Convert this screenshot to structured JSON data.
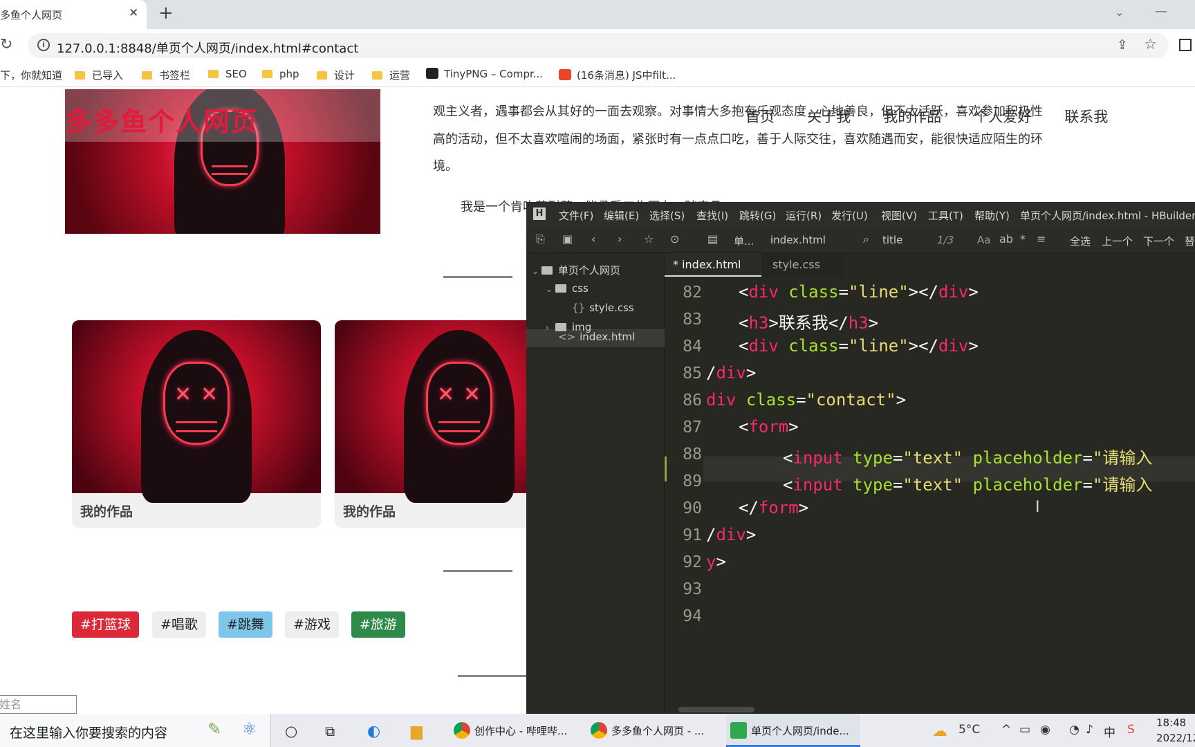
{
  "browser": {
    "tab_title": "多鱼个人网页",
    "tab_close": "✕",
    "new_tab": "+",
    "url": "127.0.0.1:8848/单页个人网页/index.html#contact",
    "bookmarks": [
      {
        "label": "下，你就知道",
        "icon": "none"
      },
      {
        "label": "已导入",
        "icon": "folder-icon"
      },
      {
        "label": "书签栏",
        "icon": "folder-icon"
      },
      {
        "label": "SEO",
        "icon": "folder-icon"
      },
      {
        "label": "php",
        "icon": "folder-icon"
      },
      {
        "label": "设计",
        "icon": "folder-icon"
      },
      {
        "label": "运营",
        "icon": "folder-icon"
      },
      {
        "label": "TinyPNG – Compr...",
        "icon": "panda-icon"
      },
      {
        "label": "(16条消息) JS中filt...",
        "icon": "csdn-icon"
      }
    ]
  },
  "webpage": {
    "logo": "多多鱼个人网页",
    "nav": [
      "首页",
      "关于我",
      "我的作品",
      "个人爱好",
      "联系我"
    ],
    "about_lines": [
      "观主义者，遇事都会从其好的一面去观察。对事情大多抱有乐观态度，心地善良，但不太活跃，喜欢参加积极性",
      "高的活动，但不太喜欢喧闹的场面，紧张时有一点点口吃，善于人际交往，喜欢随遇而安，能很快适应陌生的环",
      "境。",
      "我是一个肯吃苦耐劳，能承受工作压力，踏实且"
    ],
    "works": [
      {
        "caption": "我的作品"
      },
      {
        "caption": "我的作品"
      }
    ],
    "tags": [
      "#打篮球",
      "#唱歌",
      "#跳舞",
      "#游戏",
      "#旅游"
    ],
    "tag_colors": [
      "#dc2939",
      "#eeeeee",
      "#7ec6ea",
      "#eeeeee",
      "#2f8a4a"
    ],
    "name_input_placeholder": "姓名"
  },
  "hbuilder": {
    "menu": [
      "文件(F)",
      "编辑(E)",
      "选择(S)",
      "查找(I)",
      "跳转(G)",
      "运行(R)",
      "发行(U)",
      "视图(V)",
      "工具(T)",
      "帮助(Y)"
    ],
    "title": "单页个人网页/index.html - HBuilder",
    "toolbar": {
      "crumb_project": "单...",
      "crumb_file": "index.html",
      "search_term": "title",
      "match_count": "1/3",
      "case_label": "Aa",
      "select_all": "全选",
      "prev": "上一个",
      "next": "下一个",
      "replace": "替"
    },
    "tree": {
      "project": "单页个人网页",
      "css_folder": "css",
      "css_file": "style.css",
      "img_folder": "img",
      "index_file": "index.html"
    },
    "tabs": {
      "active": "* index.html",
      "inactive": "style.css"
    },
    "code_lines": [
      {
        "n": "82",
        "text": "<div class=\"line\"></div>"
      },
      {
        "n": "83",
        "text": "<h3>联系我</h3>"
      },
      {
        "n": "84",
        "text": "<div class=\"line\"></div>"
      },
      {
        "n": "85",
        "text": "/div>"
      },
      {
        "n": "86",
        "text": "div class=\"contact\">"
      },
      {
        "n": "87",
        "text": "<form>"
      },
      {
        "n": "88",
        "text": "<input type=\"text\" placeholder=\"请输入"
      },
      {
        "n": "89",
        "text": "<input type=\"text\" placeholder=\"请输入"
      },
      {
        "n": "90",
        "text": "</form>"
      },
      {
        "n": "91",
        "text": "/div>"
      },
      {
        "n": "92",
        "text": "y>"
      },
      {
        "n": "93",
        "text": ""
      },
      {
        "n": "94",
        "text": ""
      }
    ],
    "code_tokens": {
      "div": "div",
      "class": "class",
      "line_val": "\"line\"",
      "h3": "h3",
      "h3_text": "联系我",
      "contact_val": "\"contact\"",
      "form": "form",
      "input": "input",
      "type": "type",
      "text_val": "\"text\"",
      "placeholder": "placeholder",
      "ph_val": "\"请输入"
    }
  },
  "taskbar": {
    "search_placeholder": "在这里输入你要搜索的内容",
    "apps": [
      {
        "label": "创作中心 - 哔哩哔..."
      },
      {
        "label": "多多鱼个人网页 - ..."
      },
      {
        "label": "单页个人网页/inde..."
      }
    ],
    "weather": "5°C",
    "time": "18:48",
    "date": "2022/12",
    "ime": "中"
  }
}
